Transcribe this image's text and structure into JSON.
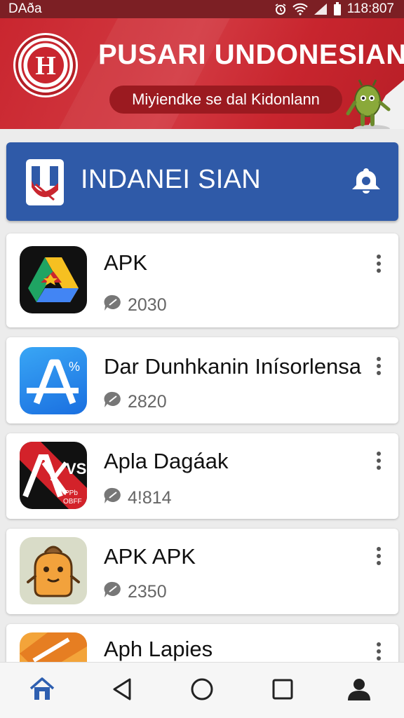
{
  "status_bar": {
    "carrier": "DAða",
    "time": "118:807",
    "icons": [
      "alarm-icon",
      "wifi-icon",
      "signal-icon",
      "battery-icon"
    ]
  },
  "banner": {
    "logo_letter": "H",
    "title": "PUSARI UNDONESIAN",
    "subtitle": "Miyiendke se dal Kidonlann"
  },
  "header": {
    "title": "INDANEI SIAN",
    "bell_icon": "bell-icon"
  },
  "apps": [
    {
      "name": "APK",
      "count": "2030",
      "icon": "drive-app-icon"
    },
    {
      "name": "Dar Dunhkanin Inísorlensa",
      "count": "2820",
      "icon": "app-store-icon"
    },
    {
      "name": "Apla Dagáak",
      "count": "4!814",
      "icon": "ax-app-icon",
      "icon_text": "VS",
      "icon_subtext": "PPb OBFF"
    },
    {
      "name": "APK APK",
      "count": "2350",
      "icon": "mascot-app-icon"
    },
    {
      "name": "Aph Lapies",
      "count": "",
      "icon": "orange-app-icon"
    }
  ],
  "nav": [
    "home-icon",
    "back-icon",
    "home-circle-icon",
    "recents-icon",
    "profile-icon"
  ],
  "colors": {
    "banner_red": "#c9262f",
    "header_blue": "#2f5aa8",
    "nav_active": "#2e5fb0"
  }
}
